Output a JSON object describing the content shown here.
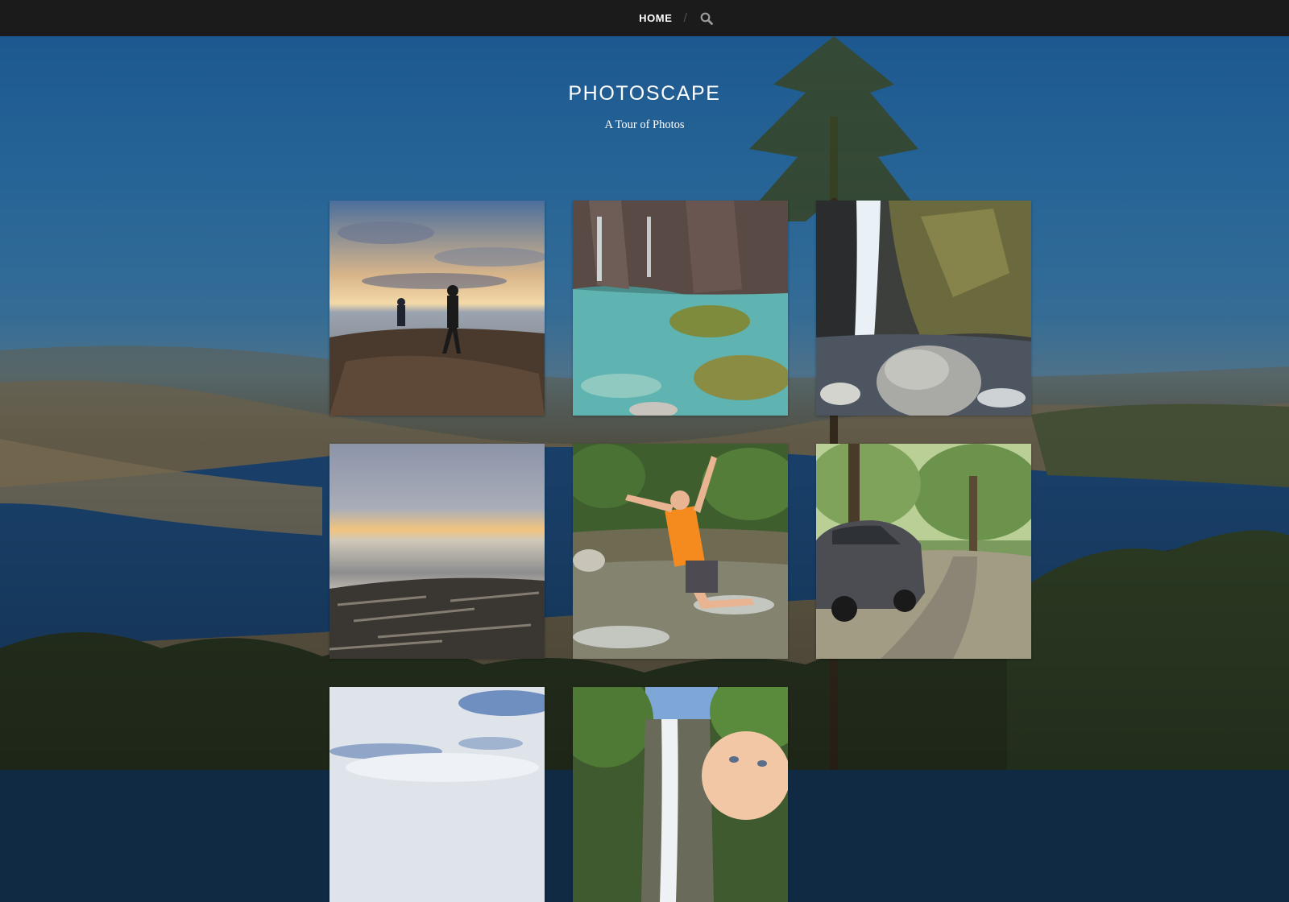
{
  "nav": {
    "home_label": "HOME",
    "separator": "/",
    "search_icon": "search-icon"
  },
  "header": {
    "title": "PHOTOSCAPE",
    "tagline": "A Tour of Photos"
  },
  "posts": [
    {
      "subject": "sunset beach silhouettes"
    },
    {
      "subject": "clear pool with waterfalls"
    },
    {
      "subject": "waterfall with boulder"
    },
    {
      "subject": "beach sunset with driftwood"
    },
    {
      "subject": "boy jumping in river"
    },
    {
      "subject": "car on forest road"
    },
    {
      "subject": "cloudy sky"
    },
    {
      "subject": "waterfall with baby"
    }
  ],
  "colors": {
    "nav_background": "#1b1b1b",
    "text": "#ffffff"
  }
}
